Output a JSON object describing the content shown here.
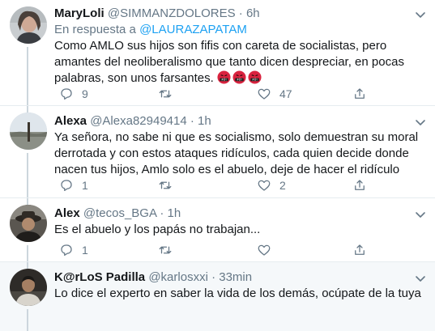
{
  "tweets": [
    {
      "name": "MaryLoli",
      "handle": "@SIMMANZDOLORES",
      "dot": "·",
      "time": "6h",
      "reply_prefix": "En respuesta a",
      "reply_mention": "@LAURAZAPATAM",
      "text": "Como AMLO sus hijos son fifis con careta de socialistas, pero amantes del neoliberalismo que tanto dicen despreciar, en pocas palabras, son unos farsantes.",
      "emoji_icon": "cursing-face-icon",
      "emoji_count": 3,
      "reply_count": "9",
      "retweet_count": "",
      "like_count": "47"
    },
    {
      "name": "Alexa",
      "handle": "@Alexa82949414",
      "dot": "·",
      "time": "1h",
      "text": "Ya señora, no sabe ni que es socialismo, solo demuestran su moral derrotada y con estos ataques ridículos, cada quien decide donde nacen tus hijos, Amlo solo es el abuelo, deje de hacer el ridículo",
      "reply_count": "1",
      "retweet_count": "",
      "like_count": "2"
    },
    {
      "name": "Alex",
      "handle": "@tecos_BGA",
      "dot": "·",
      "time": "1h",
      "text": "Es el abuelo y los papás no trabajan...",
      "reply_count": "1",
      "retweet_count": "",
      "like_count": ""
    },
    {
      "name": "K@rLoS Padilla",
      "handle": "@karlosxxi",
      "dot": "·",
      "time": "33min",
      "text": "Lo dice el experto en saber la vida de los demás, ocúpate de la tuya",
      "reply_count": "",
      "retweet_count": "",
      "like_count": ""
    }
  ],
  "colors": {
    "name": "#14171a",
    "secondary": "#657786",
    "mention": "#1da1f2",
    "divider": "#e6ecf0",
    "highlight_bg": "#f5f8fa"
  }
}
